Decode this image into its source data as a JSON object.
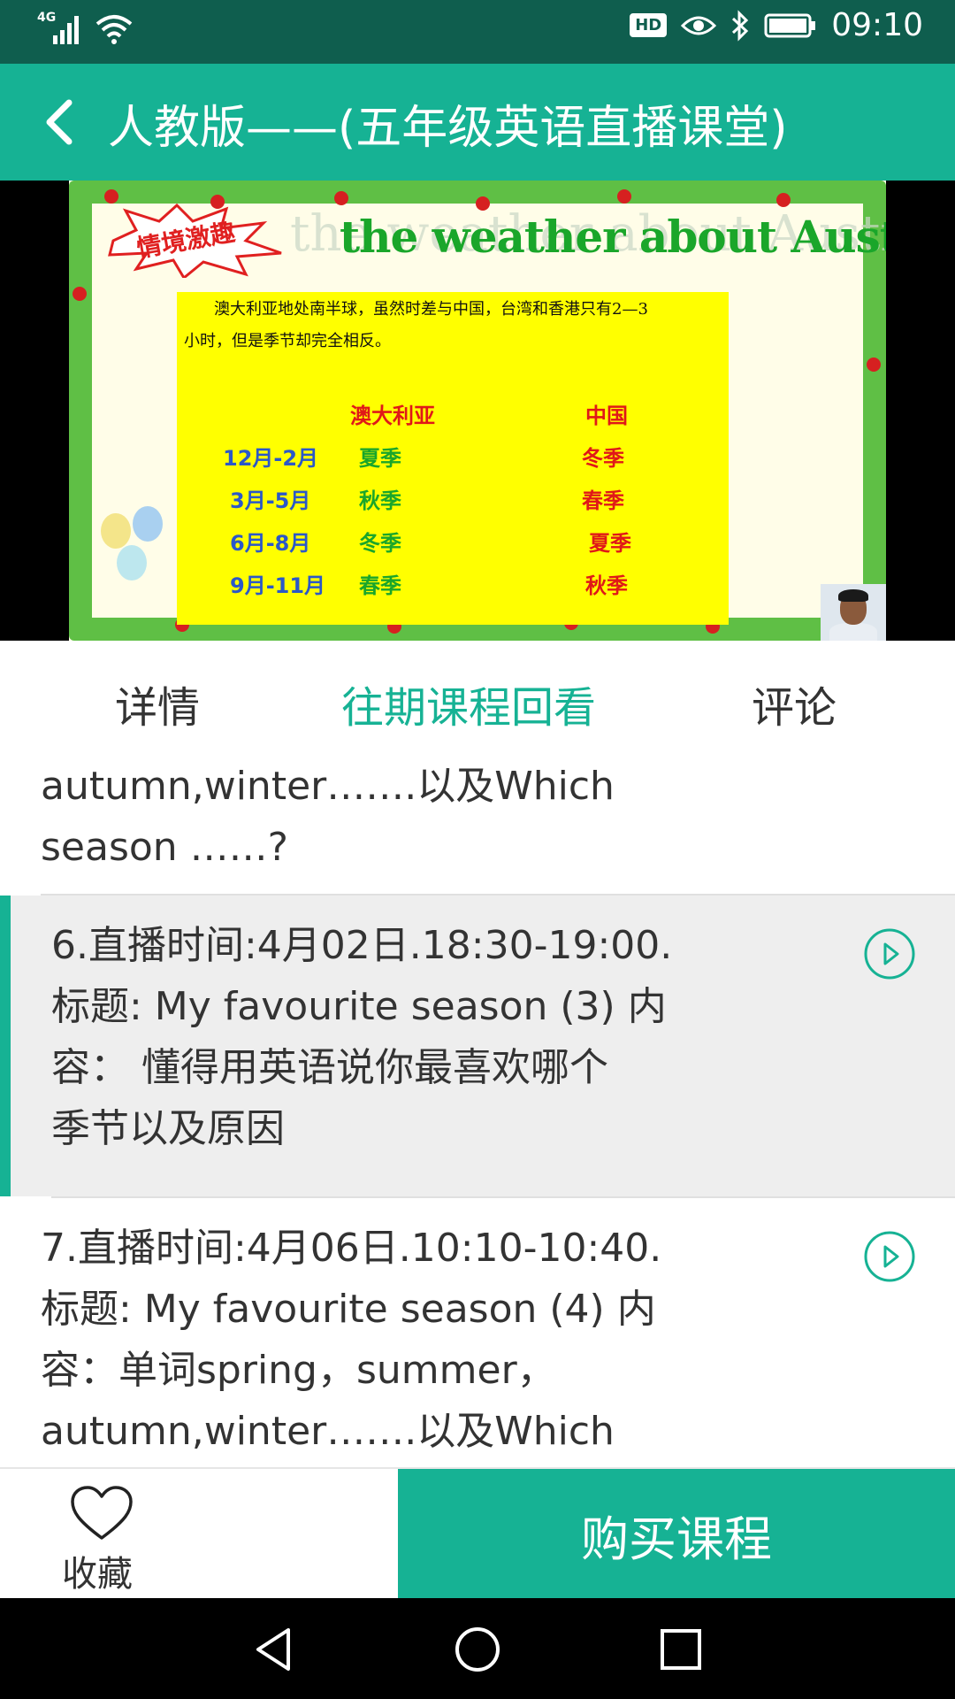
{
  "status_bar": {
    "network": "4G",
    "time": "09:10",
    "hd_badge": "HD",
    "icons": [
      "signal-icon",
      "wifi-icon",
      "hd-icon",
      "eye-icon",
      "bluetooth-icon",
      "battery-icon"
    ]
  },
  "header": {
    "title": "人教版——(五年级英语直播课堂)",
    "back_icon": "chevron-left-icon"
  },
  "video": {
    "slide_title": "the weather about Australia",
    "burst_label": "情境激趣",
    "intro_line1": "澳大利亚地处南半球，虽然时差与中国，台湾和香港只有2—3",
    "intro_line2": "小时，但是季节却完全相反。",
    "table": {
      "headers": [
        "澳大利亚",
        "中国"
      ],
      "rows": [
        {
          "months": "12月-2月",
          "australia": "夏季",
          "china": "冬季"
        },
        {
          "months": "3月-5月",
          "australia": "秋季",
          "china": "春季"
        },
        {
          "months": "6月-8月",
          "australia": "冬季",
          "china": "夏季"
        },
        {
          "months": "9月-11月",
          "australia": "春季",
          "china": "秋季"
        }
      ]
    }
  },
  "tabs": [
    {
      "label": "详情",
      "active": false
    },
    {
      "label": "往期课程回看",
      "active": true
    },
    {
      "label": "评论",
      "active": false
    }
  ],
  "content": {
    "prev_tail_line1": "autumn,winter…….以及Which",
    "prev_tail_line2": "season ……?",
    "lessons": [
      {
        "line1": "6.直播时间:4月02日.18:30-19:00.",
        "line2": "标题: My favourite season (3) 内",
        "line3": "容：  懂得用英语说你最喜欢哪个",
        "line4": "季节以及原因",
        "selected": true
      },
      {
        "line1": "7.直播时间:4月06日.10:10-10:40.",
        "line2": "标题: My favourite season (4) 内",
        "line3": "容：单词spring，summer，",
        "line4": "autumn,winter…….以及Which",
        "selected": false
      }
    ]
  },
  "bottom_bar": {
    "favorite_label": "收藏",
    "buy_label": "购买课程"
  },
  "colors": {
    "accent": "#16b294",
    "status_bar": "#0f5e4e"
  }
}
